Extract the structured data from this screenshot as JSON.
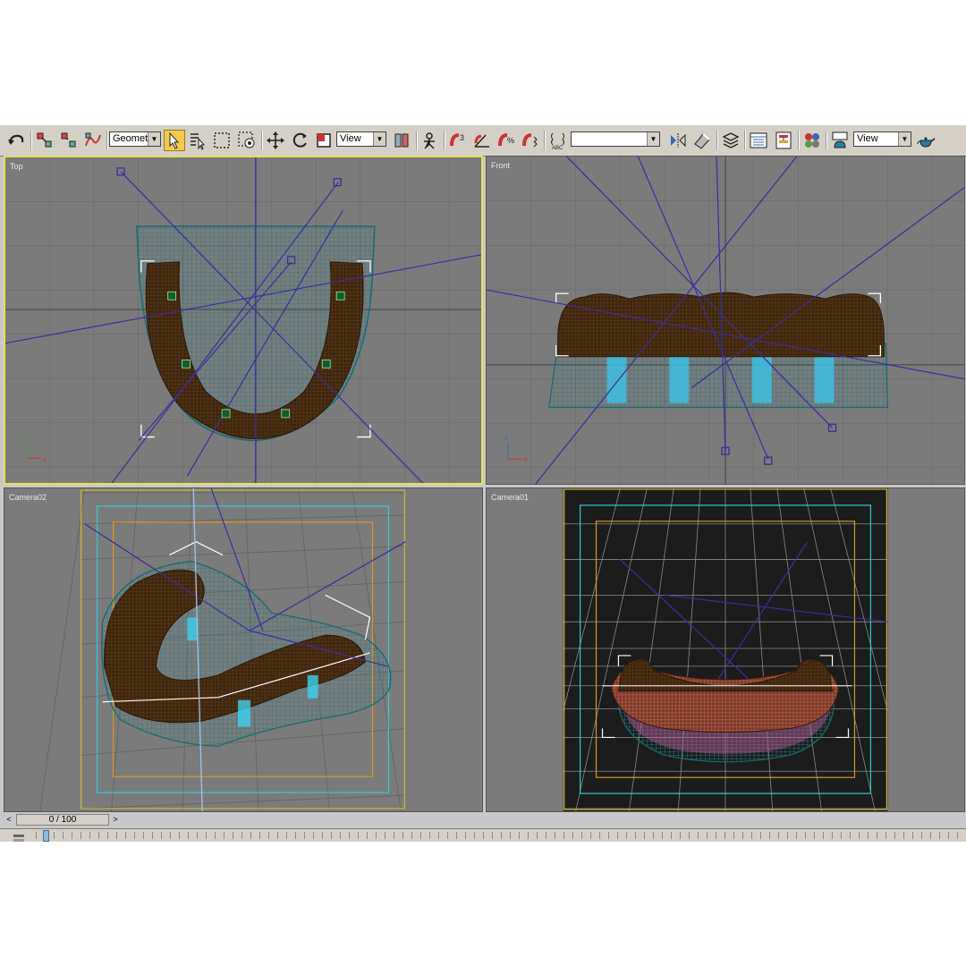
{
  "toolbar": {
    "selection_filter": "Geometry",
    "ref_coord_system": "View",
    "named_selection_set": "",
    "render_type": "View"
  },
  "viewports": {
    "top": {
      "label": "Top"
    },
    "front": {
      "label": "Front"
    },
    "camera02": {
      "label": "Camera02"
    },
    "camera01": {
      "label": "Camera01"
    }
  },
  "axes": {
    "x": "x",
    "y": "y",
    "z": "z"
  },
  "timeline": {
    "slider_text": "0 / 100",
    "prev_arrow": "<",
    "next_arrow": ">"
  },
  "colors": {
    "viewport_bg": "#7b7b7b",
    "grid": "#636363",
    "active_border": "#e8e05a",
    "gum_wire": "#1f7b86",
    "teeth": "#4a2e10",
    "light_lines": "#3a2f9a",
    "highlight_cyan": "#3fd0f0",
    "camera_bg": "#1c1c1c",
    "safe_frame_cyan": "#35c9d6",
    "safe_frame_orange": "#d9962a"
  }
}
